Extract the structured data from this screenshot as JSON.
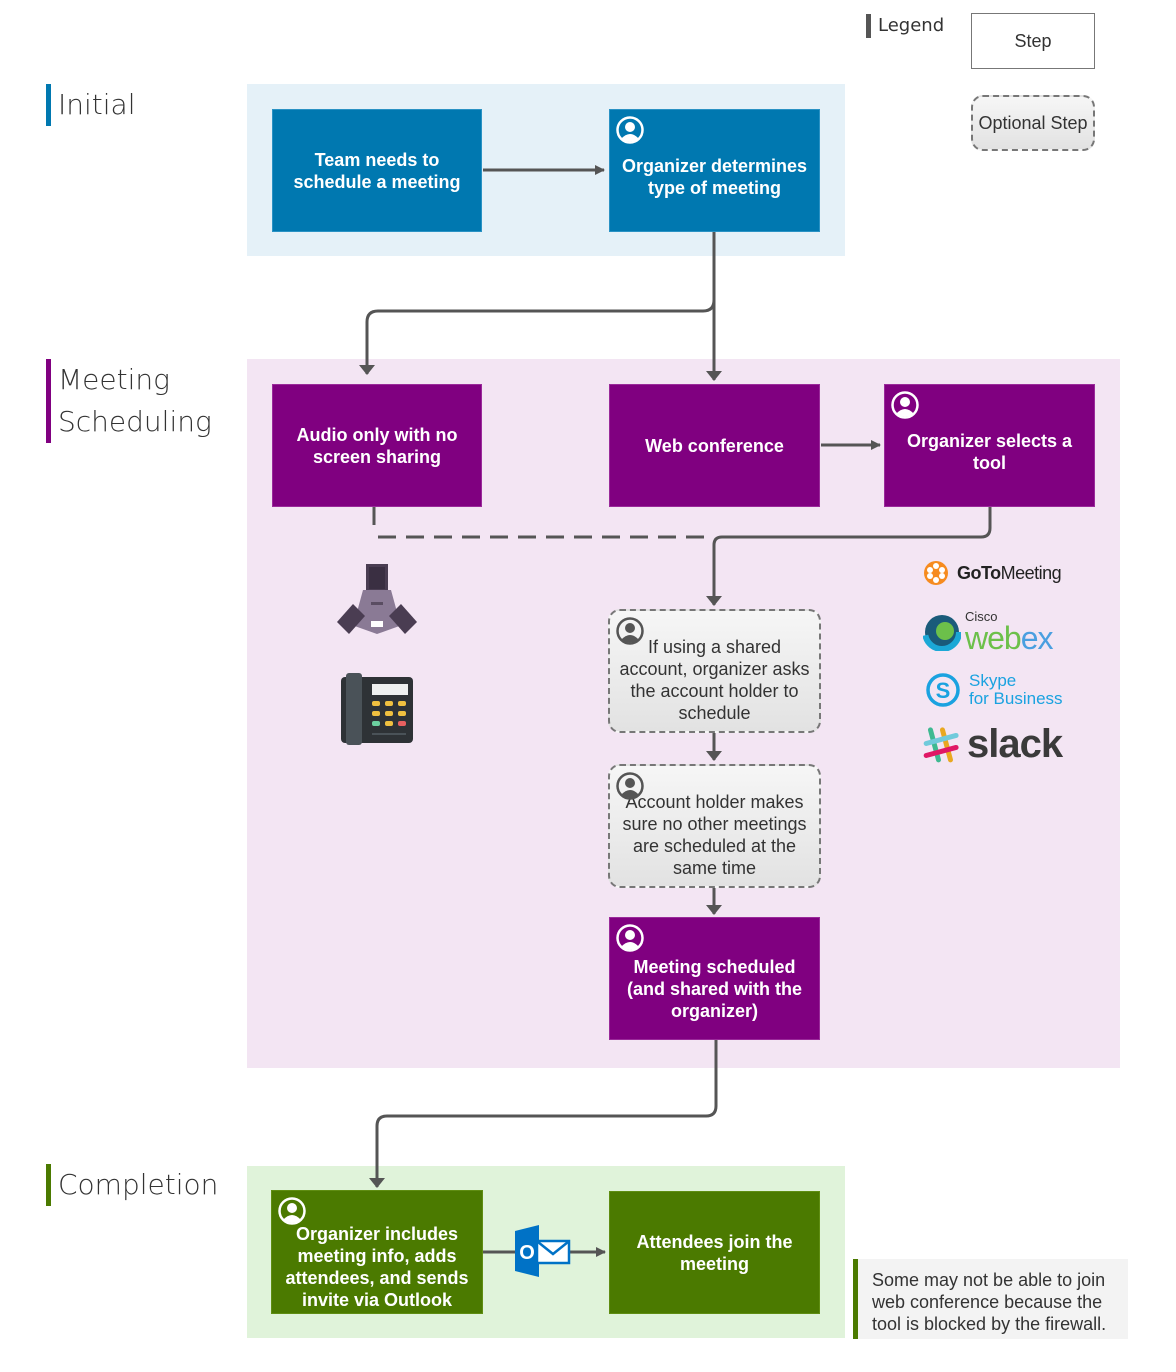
{
  "legend": {
    "title": "Legend",
    "step_label": "Step",
    "optional_step_label": "Optional Step"
  },
  "colors": {
    "initial": "#0078b0",
    "initial_lane": "#e5f1f8",
    "scheduling": "#800080",
    "scheduling_lane": "#f3e5f3",
    "completion": "#4b7a00",
    "completion_lane": "#e0f3da",
    "connector": "#555555"
  },
  "phases": [
    {
      "name": "Initial",
      "label": "Initial"
    },
    {
      "name": "Meeting Scheduling",
      "label": "Meeting\nScheduling"
    },
    {
      "name": "Completion",
      "label": "Completion"
    }
  ],
  "steps": {
    "team_needs": {
      "label": "Team needs to schedule a meeting",
      "type": "step",
      "actor": false
    },
    "organizer_determines": {
      "label": "Organizer determines type of meeting",
      "type": "step",
      "actor": true
    },
    "audio_only": {
      "label": "Audio only with no screen sharing",
      "type": "step",
      "actor": false
    },
    "web_conference": {
      "label": "Web conference",
      "type": "step",
      "actor": false
    },
    "organizer_selects": {
      "label": "Organizer selects a tool",
      "type": "step",
      "actor": true
    },
    "shared_account": {
      "label": "If using a shared account, organizer asks the account holder to schedule",
      "type": "optional",
      "actor": true
    },
    "account_holder": {
      "label": "Account holder makes sure no other meetings are scheduled at the same time",
      "type": "optional",
      "actor": true
    },
    "meeting_scheduled": {
      "label": "Meeting scheduled (and shared with the organizer)",
      "type": "step",
      "actor": true
    },
    "organizer_includes": {
      "label": "Organizer includes meeting info, adds attendees, and sends invite via Outlook",
      "type": "step",
      "actor": true
    },
    "attendees_join": {
      "label": "Attendees join the meeting",
      "type": "step",
      "actor": false
    }
  },
  "tools": {
    "goto_bold": "GoTo",
    "goto_rest": "Meeting",
    "webex_small": "Cisco",
    "webex_web": "web",
    "webex_ex": "ex",
    "skype_line1": "Skype",
    "skype_line2": "for Business",
    "slack": "slack"
  },
  "audio_devices": [
    "conference-phone",
    "desk-phone"
  ],
  "outlook_icon_letter": "O",
  "note": "Some may not be able to join web conference because the tool is blocked by the firewall."
}
